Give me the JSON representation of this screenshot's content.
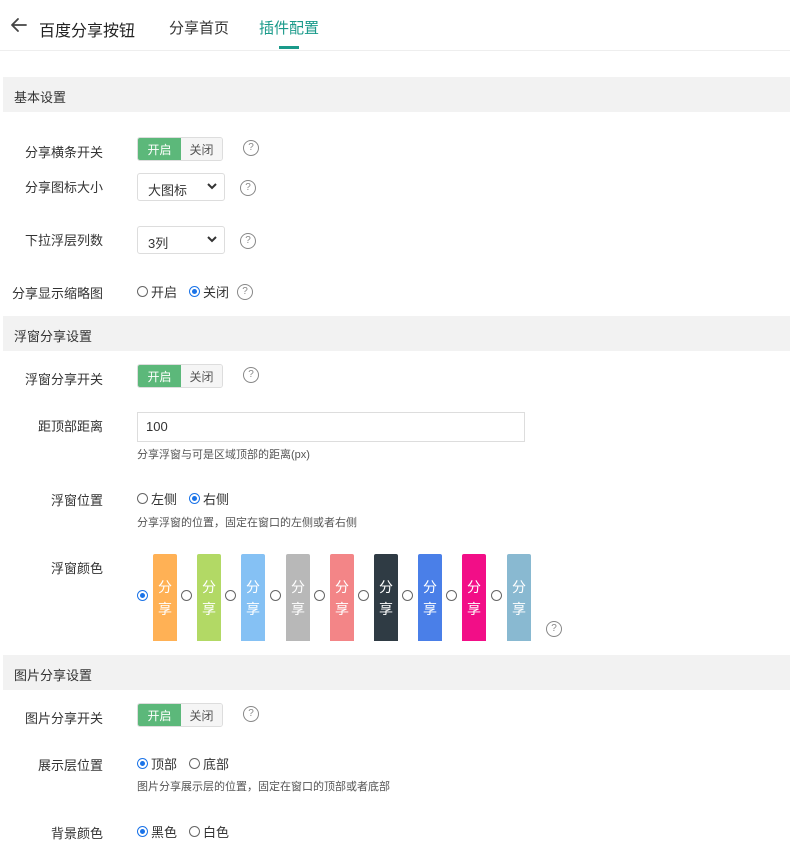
{
  "header": {
    "title": "百度分享按钮",
    "tabs": [
      {
        "label": "分享首页",
        "active": false
      },
      {
        "label": "插件配置",
        "active": true
      }
    ]
  },
  "sections": {
    "basic": {
      "title": "基本设置",
      "share_bar": {
        "label": "分享横条开关",
        "on": "开启",
        "off": "关闭",
        "value": "开启"
      },
      "icon_size": {
        "label": "分享图标大小",
        "value": "大图标"
      },
      "columns": {
        "label": "下拉浮层列数",
        "value": "3列"
      },
      "thumbnail": {
        "label": "分享显示缩略图",
        "options": [
          "开启",
          "关闭"
        ],
        "selected": "关闭"
      }
    },
    "float": {
      "title": "浮窗分享设置",
      "switch": {
        "label": "浮窗分享开关",
        "on": "开启",
        "off": "关闭",
        "value": "开启"
      },
      "top_distance": {
        "label": "距顶部距离",
        "value": "100",
        "hint": "分享浮窗与可是区域顶部的距离(px)"
      },
      "position": {
        "label": "浮窗位置",
        "options": [
          "左侧",
          "右侧"
        ],
        "selected": "右侧",
        "hint": "分享浮窗的位置，固定在窗口的左侧或者右侧"
      },
      "color": {
        "label": "浮窗颜色",
        "text_top": "分",
        "text_bottom": "享",
        "selected_index": 0,
        "swatches": [
          "#ffb155",
          "#b2d965",
          "#85c1f4",
          "#b8b8b8",
          "#f38587",
          "#2f3b44",
          "#4a7fe8",
          "#f20e87",
          "#89b9d1"
        ]
      }
    },
    "image": {
      "title": "图片分享设置",
      "switch": {
        "label": "图片分享开关",
        "on": "开启",
        "off": "关闭",
        "value": "开启"
      },
      "position": {
        "label": "展示层位置",
        "options": [
          "顶部",
          "底部"
        ],
        "selected": "顶部",
        "hint": "图片分享展示层的位置，固定在窗口的顶部或者底部"
      },
      "bg_color": {
        "label": "背景颜色",
        "options": [
          "黑色",
          "白色"
        ],
        "selected": "黑色"
      }
    }
  },
  "icons": {
    "back": "arrow-left-icon",
    "help": "question-circle-icon",
    "select": "chevron-down-icon"
  }
}
